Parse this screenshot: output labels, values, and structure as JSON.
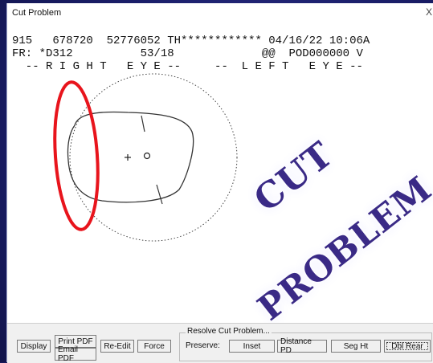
{
  "window": {
    "title": "Cut Problem",
    "close_glyph": "X"
  },
  "job": {
    "line1": "915   678720  52776052 TH************ 04/16/22 10:06A",
    "line2": "FR: *D312          53/18             @@  POD000000 V",
    "line3": "  -- R I G H T   E Y E --     --  L E F T   E Y E --"
  },
  "stamp": {
    "word1": "CUT",
    "word2": "PROBLEM"
  },
  "toolbar": {
    "display": "Display",
    "print_pdf": "Print PDF",
    "email_pdf": "Email PDF",
    "re_edit": "Re-Edit",
    "force": "Force"
  },
  "resolve": {
    "group_label": "Resolve Cut Problem...",
    "preserve_label": "Preserve:",
    "inset": "Inset",
    "distance_pd": "Distance PD",
    "seg_ht": "Seg Ht",
    "dbl_rear": "Dbl Rear"
  },
  "colors": {
    "highlight": "#e8141c",
    "stamp": "#3a2a86",
    "stamp_glow": "#ffffff"
  },
  "icons": {
    "close": "close-icon",
    "center_marker": "crosshair-icon"
  }
}
